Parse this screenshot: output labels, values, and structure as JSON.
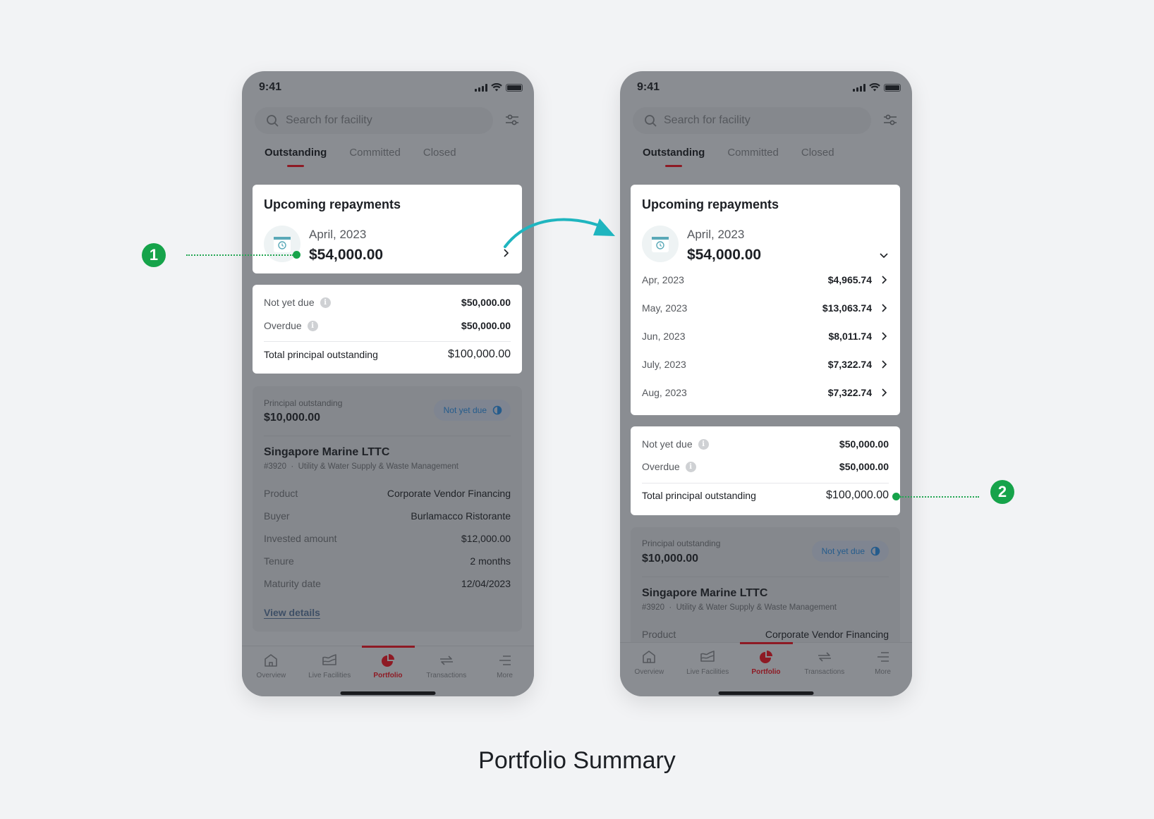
{
  "caption": "Portfolio Summary",
  "annotations": [
    {
      "number": "1"
    },
    {
      "number": "2"
    }
  ],
  "colors": {
    "accent": "#8e1a24",
    "marker": "#16a34a",
    "arrow": "#1fb5bf",
    "badge_text": "#255c8c"
  },
  "phones": [
    {
      "status": {
        "time": "9:41"
      },
      "search": {
        "placeholder": "Search for facility"
      },
      "tabs": [
        {
          "label": "Outstanding",
          "active": true
        },
        {
          "label": "Committed"
        },
        {
          "label": "Closed"
        }
      ],
      "upcoming": {
        "title": "Upcoming repayments",
        "month": "April, 2023",
        "amount": "$54,000.00",
        "expanded": false
      },
      "summary": {
        "not_yet_due_label": "Not yet due",
        "not_yet_due_value": "$50,000.00",
        "overdue_label": "Overdue",
        "overdue_value": "$50,000.00",
        "total_label": "Total principal outstanding",
        "total_value": "$100,000.00"
      },
      "facility": {
        "principal_label": "Principal outstanding",
        "principal_value": "$10,000.00",
        "badge": "Not yet due",
        "name": "Singapore Marine LTTC",
        "id": "#3920",
        "sector": "Utility & Water Supply & Waste Management",
        "details": [
          {
            "k": "Product",
            "v": "Corporate Vendor Financing"
          },
          {
            "k": "Buyer",
            "v": "Burlamacco Ristorante"
          },
          {
            "k": "Invested amount",
            "v": "$12,000.00"
          },
          {
            "k": "Tenure",
            "v": "2 months"
          },
          {
            "k": "Maturity date",
            "v": "12/04/2023"
          }
        ],
        "view_details": "View details"
      },
      "nav": [
        {
          "label": "Overview"
        },
        {
          "label": "Live Facilities"
        },
        {
          "label": "Portfolio",
          "active": true
        },
        {
          "label": "Transactions"
        },
        {
          "label": "More"
        }
      ]
    },
    {
      "status": {
        "time": "9:41"
      },
      "search": {
        "placeholder": "Search for facility"
      },
      "tabs": [
        {
          "label": "Outstanding",
          "active": true
        },
        {
          "label": "Committed"
        },
        {
          "label": "Closed"
        }
      ],
      "upcoming": {
        "title": "Upcoming repayments",
        "month": "April, 2023",
        "amount": "$54,000.00",
        "expanded": true,
        "schedule": [
          {
            "month": "Apr, 2023",
            "amount": "$4,965.74"
          },
          {
            "month": "May, 2023",
            "amount": "$13,063.74"
          },
          {
            "month": "Jun, 2023",
            "amount": "$8,011.74"
          },
          {
            "month": "July, 2023",
            "amount": "$7,322.74"
          },
          {
            "month": "Aug, 2023",
            "amount": "$7,322.74"
          }
        ]
      },
      "summary": {
        "not_yet_due_label": "Not yet due",
        "not_yet_due_value": "$50,000.00",
        "overdue_label": "Overdue",
        "overdue_value": "$50,000.00",
        "total_label": "Total principal outstanding",
        "total_value": "$100,000.00"
      },
      "facility": {
        "principal_label": "Principal outstanding",
        "principal_value": "$10,000.00",
        "badge": "Not yet due",
        "name": "Singapore Marine LTTC",
        "id": "#3920",
        "sector": "Utility & Water Supply & Waste Management",
        "details": [
          {
            "k": "Product",
            "v": "Corporate Vendor Financing"
          }
        ]
      },
      "nav": [
        {
          "label": "Overview"
        },
        {
          "label": "Live Facilities"
        },
        {
          "label": "Portfolio",
          "active": true
        },
        {
          "label": "Transactions"
        },
        {
          "label": "More"
        }
      ]
    }
  ]
}
